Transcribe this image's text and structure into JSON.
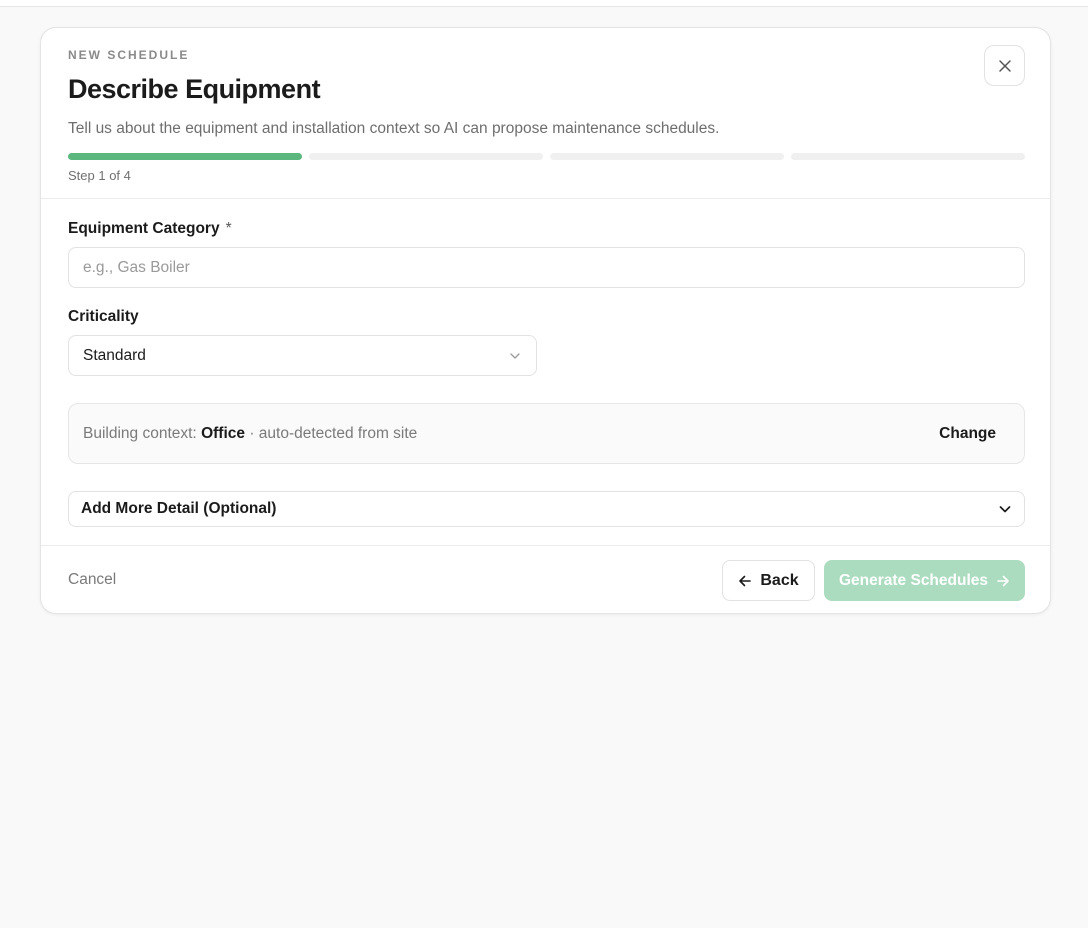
{
  "colors": {
    "progress_active": "#5cb77f",
    "progress_inactive": "#f0f0f0",
    "primary_disabled": "#acdcbf",
    "background": "#f9f9f9"
  },
  "dialog": {
    "eyebrow": "NEW SCHEDULE",
    "title": "Describe Equipment",
    "subtitle": "Tell us about the equipment and installation context so AI can propose maintenance schedules.",
    "close_icon": "close-icon",
    "progress": {
      "current_step": 1,
      "total_steps": 4,
      "label": "Step 1 of 4"
    }
  },
  "form": {
    "category": {
      "label": "Equipment Category",
      "required_mark": "*",
      "placeholder": "e.g., Gas Boiler",
      "value": ""
    },
    "criticality": {
      "label": "Criticality",
      "selected": "Standard",
      "icon": "chevron-down-icon"
    },
    "building_context": {
      "prefix": "Building context:",
      "value": "Office",
      "suffix": "· auto-detected from site",
      "change_label": "Change"
    },
    "more_detail": {
      "label": "Add More Detail (Optional)",
      "icon": "chevron-down-icon"
    }
  },
  "footer": {
    "cancel_label": "Cancel",
    "back_label": "Back",
    "back_icon": "arrow-left-icon",
    "generate_label": "Generate Schedules",
    "generate_icon": "arrow-right-icon"
  }
}
